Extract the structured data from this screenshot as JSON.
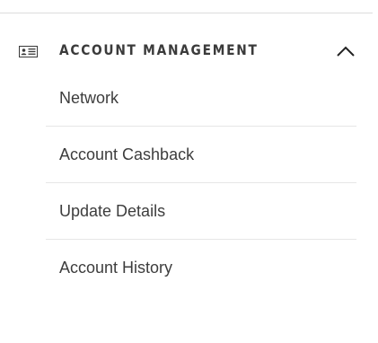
{
  "section": {
    "title": "ACCOUNT MANAGEMENT",
    "icon": "id-card-icon",
    "toggle_icon": "chevron-up-icon",
    "expanded": true
  },
  "menu": {
    "items": [
      {
        "label": "Network"
      },
      {
        "label": "Account Cashback"
      },
      {
        "label": "Update Details"
      },
      {
        "label": "Account History"
      }
    ]
  },
  "colors": {
    "text": "#3d3d3d",
    "divider": "#e6e6e6",
    "background": "#ffffff"
  }
}
